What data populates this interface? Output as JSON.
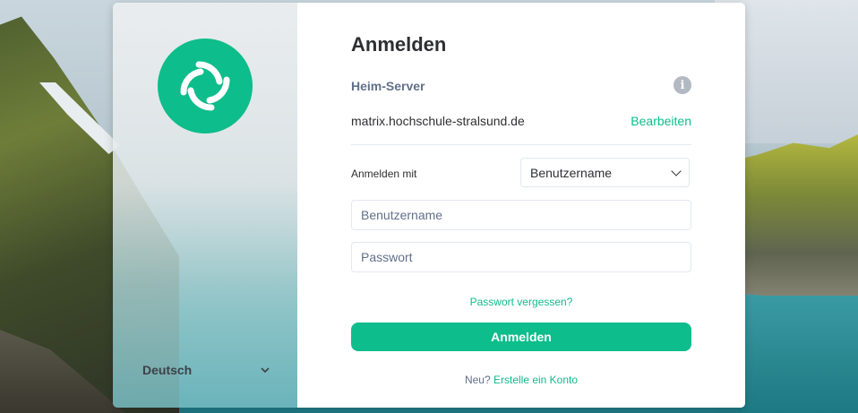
{
  "colors": {
    "accent": "#0dbd8b",
    "text_primary": "#2e2f32",
    "text_secondary": "#61708b",
    "border": "#e3e8f0"
  },
  "sidebar": {
    "logo_icon": "element-logo-icon",
    "language": "Deutsch"
  },
  "login": {
    "title": "Anmelden",
    "homeserver_label": "Heim-Server",
    "info_icon": "info-icon",
    "homeserver_value": "matrix.hochschule-stralsund.de",
    "edit_label": "Bearbeiten",
    "login_with_label": "Anmelden mit",
    "login_with_selected": "Benutzername",
    "username_placeholder": "Benutzername",
    "password_placeholder": "Passwort",
    "forgot_password": "Passwort vergessen?",
    "submit_label": "Anmelden",
    "new_prefix": "Neu?",
    "create_account": "Erstelle ein Konto"
  }
}
